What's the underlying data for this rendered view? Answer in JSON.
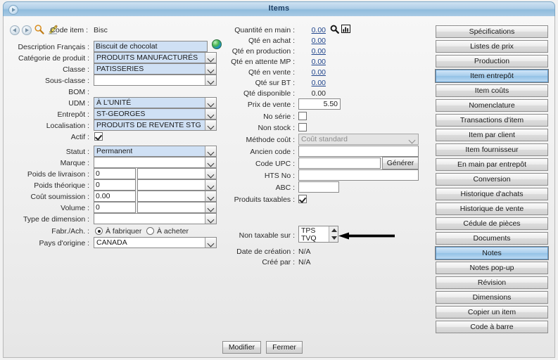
{
  "window": {
    "title": "Items",
    "menu_icon": "window-menu-icon"
  },
  "toolbar": {
    "back_icon": "back-arrow-icon",
    "forward_icon": "forward-arrow-icon",
    "search_icon": "magnifier-icon",
    "edit_icon": "pencil-edit-icon",
    "code_item_label": "Code item :",
    "code_item_value": "Bisc"
  },
  "left_form": {
    "fields": [
      {
        "label": "Description Français :",
        "value": "Biscuit de chocolat",
        "type": "text",
        "filled": true
      },
      {
        "label": "Catégorie de produit :",
        "value": "PRODUITS MANUFACTURÉS",
        "type": "combo",
        "filled": true
      },
      {
        "label": "Classe :",
        "value": "PATISSERIES",
        "type": "combo",
        "filled": true
      },
      {
        "label": "Sous-classe :",
        "value": "",
        "type": "combo",
        "filled": false
      },
      {
        "label": "BOM :",
        "value": "",
        "type": "none",
        "filled": false
      },
      {
        "label": "UDM :",
        "value": "À L'UNITÉ",
        "type": "combo",
        "filled": true
      },
      {
        "label": "Entrepôt :",
        "value": "ST-GEORGES",
        "type": "combo",
        "filled": true
      },
      {
        "label": "Localisation  :",
        "value": "PRODUITS DE REVENTE STG",
        "type": "combo",
        "filled": true
      },
      {
        "label": "Actif :",
        "value": "",
        "type": "checkbox",
        "checked": true
      },
      {
        "label": "Statut :",
        "value": "Permanent",
        "type": "combo",
        "filled": true
      },
      {
        "label": "Marque :",
        "value": "",
        "type": "combo",
        "filled": false
      },
      {
        "label": "Poids de livraison :",
        "value": "0",
        "type": "text-combo",
        "filled": false
      },
      {
        "label": "Poids théorique :",
        "value": "0",
        "type": "text-combo",
        "filled": false
      },
      {
        "label": "Coût soumission :",
        "value": "0.00",
        "type": "text-combo",
        "filled": false
      },
      {
        "label": "Volume :",
        "value": "0",
        "type": "text-combo",
        "filled": false
      },
      {
        "label": "Type de dimension :",
        "value": "",
        "type": "combo",
        "filled": false
      },
      {
        "label": "Fabr./Ach. :",
        "value": "",
        "type": "radio"
      },
      {
        "label": "Pays d'origine :",
        "value": "CANADA",
        "type": "combo",
        "filled": false
      }
    ],
    "globe_icon": "globe-icon",
    "radio_options": [
      {
        "label": "À fabriquer",
        "selected": true
      },
      {
        "label": "À acheter",
        "selected": false
      }
    ]
  },
  "middle_form": {
    "quantities": [
      {
        "label": "Quantité en main :",
        "value": "0.00",
        "link": true
      },
      {
        "label": "Qté en achat :",
        "value": "0.00",
        "link": true
      },
      {
        "label": "Qté en production :",
        "value": "0.00",
        "link": true
      },
      {
        "label": "Qté en attente MP :",
        "value": "0.00",
        "link": true
      },
      {
        "label": "Qté en vente :",
        "value": "0.00",
        "link": true
      },
      {
        "label": "Qté sur BT :",
        "value": "0.00",
        "link": true
      },
      {
        "label": "Qté disponible :",
        "value": "0.00",
        "link": false
      }
    ],
    "qty_search_icon": "magnifier-icon",
    "qty_chart_icon": "bar-chart-icon",
    "prix_de_vente_label": "Prix de vente :",
    "prix_de_vente_value": "5.50",
    "no_serie_label": "No série :",
    "no_serie_checked": false,
    "non_stock_label": "Non stock :",
    "non_stock_checked": false,
    "methode_cout_label": "Méthode coût :",
    "methode_cout_value": "Coût standard",
    "ancien_code_label": "Ancien code :",
    "ancien_code_value": "",
    "code_upc_label": "Code UPC :",
    "code_upc_value": "",
    "generer_label": "Générer",
    "hts_no_label": "HTS No :",
    "hts_no_value": "",
    "abc_label": "ABC :",
    "abc_value": "",
    "produits_taxables_label": "Produits taxables :",
    "produits_taxables_checked": true,
    "non_taxable_label": "Non taxable sur :",
    "non_taxable_options": [
      "TPS",
      "TVQ"
    ],
    "date_creation_label": "Date de création :",
    "date_creation_value": "N/A",
    "cree_par_label": "Créé par :",
    "cree_par_value": "N/A"
  },
  "side_buttons": [
    {
      "label": "Spécifications",
      "selected": false
    },
    {
      "label": "Listes de prix",
      "selected": false
    },
    {
      "label": "Production",
      "selected": false
    },
    {
      "label": "Item entrepôt",
      "selected": true
    },
    {
      "label": "Item coûts",
      "selected": false
    },
    {
      "label": "Nomenclature",
      "selected": false
    },
    {
      "label": "Transactions d'item",
      "selected": false
    },
    {
      "label": "Item par client",
      "selected": false
    },
    {
      "label": "Item fournisseur",
      "selected": false
    },
    {
      "label": "En main par entrepôt",
      "selected": false
    },
    {
      "label": "Conversion",
      "selected": false
    },
    {
      "label": "Historique d'achats",
      "selected": false
    },
    {
      "label": "Historique de vente",
      "selected": false
    },
    {
      "label": "Cédule de pièces",
      "selected": false
    },
    {
      "label": "Documents",
      "selected": false
    },
    {
      "label": "Notes",
      "selected": true
    },
    {
      "label": "Notes pop-up",
      "selected": false
    },
    {
      "label": "Révision",
      "selected": false
    },
    {
      "label": "Dimensions",
      "selected": false
    },
    {
      "label": "Copier un item",
      "selected": false
    },
    {
      "label": "Code à barre",
      "selected": false
    }
  ],
  "footer": {
    "modifier_label": "Modifier",
    "fermer_label": "Fermer"
  },
  "annotation": {
    "arrow_icon": "left-pointing-arrow-annotation",
    "color": "#000000"
  },
  "colors": {
    "titlebar_accent": "#8fbcdd",
    "filled_input": "#cfe0f4",
    "selected_button": "#aacfed",
    "link_text": "#20458c",
    "background": "#eeeeee"
  }
}
